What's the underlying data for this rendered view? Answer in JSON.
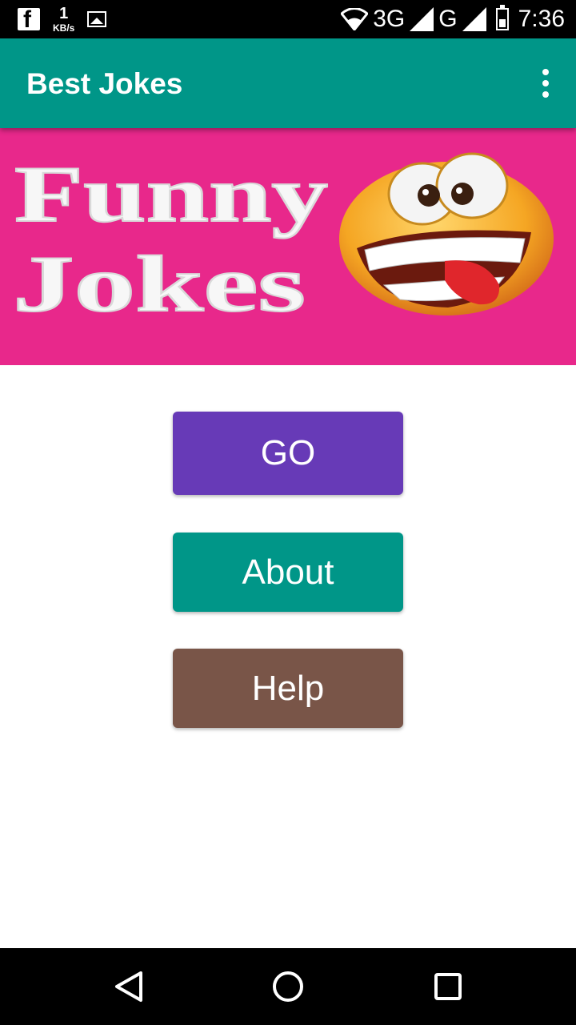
{
  "status_bar": {
    "data_rate_value": "1",
    "data_rate_unit": "KB/s",
    "network_label_1": "3G",
    "network_label_2": "G",
    "time": "7:36",
    "icons": [
      "facebook-icon",
      "image-icon",
      "wifi-icon",
      "signal-icon",
      "battery-icon"
    ]
  },
  "app_bar": {
    "title": "Best Jokes",
    "overflow_icon": "more-vert-icon",
    "color": "#009688"
  },
  "banner": {
    "line1": "Funny",
    "line2": "Jokes",
    "background": "#e8288b",
    "image": "laughing-emoji-icon"
  },
  "buttons": {
    "go": "GO",
    "about": "About",
    "help": "Help",
    "colors": {
      "go": "#673ab7",
      "about": "#009688",
      "help": "#795548"
    }
  },
  "nav_bar": {
    "icons": [
      "back-icon",
      "home-icon",
      "recents-icon"
    ]
  }
}
